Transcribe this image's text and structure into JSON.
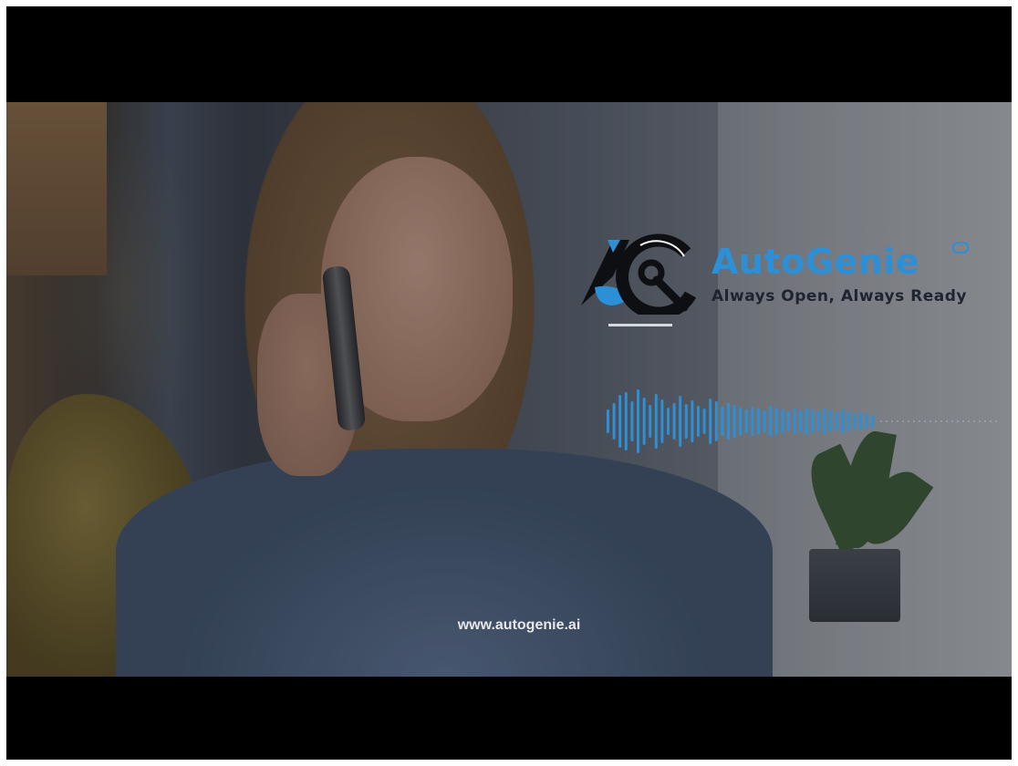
{
  "brand": {
    "name": "AutoGenie",
    "tagline": "Always Open, Always Ready",
    "website": "www.autogenie.ai",
    "accent_color": "#2d8fd6",
    "logo_icon": "ag-wrench-logo-icon"
  },
  "media": {
    "scene": "woman-on-phone-video-frame",
    "waveform_icon": "audio-waveform-icon"
  }
}
